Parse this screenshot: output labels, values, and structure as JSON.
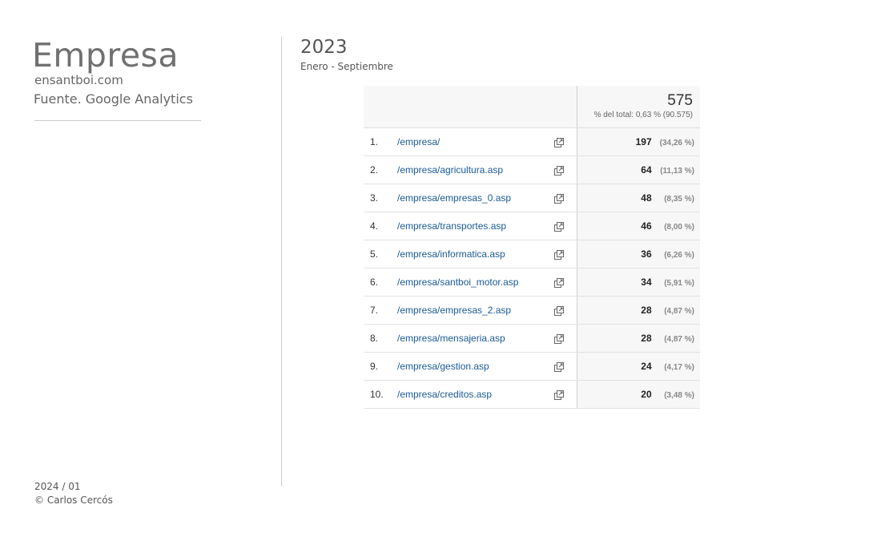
{
  "brand": {
    "title": "Empresa",
    "site": "ensantboi.com",
    "source": "Fuente. Google Analytics"
  },
  "footer": {
    "date": "2024 / 01",
    "copyright": "© Carlos Cercós"
  },
  "period": {
    "year": "2023",
    "range": "Enero - Septiembre"
  },
  "table": {
    "total_value": "575",
    "total_share": "% del total: 0,63 % (90.575)",
    "link_icon": "external-link-icon",
    "rows": [
      {
        "index": "1.",
        "page": "/empresa/",
        "value": "197",
        "pct": "(34,26 %)"
      },
      {
        "index": "2.",
        "page": "/empresa/agricultura.asp",
        "value": "64",
        "pct": "(11,13 %)"
      },
      {
        "index": "3.",
        "page": "/empresa/empresas_0.asp",
        "value": "48",
        "pct": "(8,35 %)"
      },
      {
        "index": "4.",
        "page": "/empresa/transportes.asp",
        "value": "46",
        "pct": "(8,00 %)"
      },
      {
        "index": "5.",
        "page": "/empresa/informatica.asp",
        "value": "36",
        "pct": "(6,26 %)"
      },
      {
        "index": "6.",
        "page": "/empresa/santboi_motor.asp",
        "value": "34",
        "pct": "(5,91 %)"
      },
      {
        "index": "7.",
        "page": "/empresa/empresas_2.asp",
        "value": "28",
        "pct": "(4,87 %)"
      },
      {
        "index": "8.",
        "page": "/empresa/mensajeria.asp",
        "value": "28",
        "pct": "(4,87 %)"
      },
      {
        "index": "9.",
        "page": "/empresa/gestion.asp",
        "value": "24",
        "pct": "(4,17 %)"
      },
      {
        "index": "10.",
        "page": "/empresa/creditos.asp",
        "value": "20",
        "pct": "(3,48 %)"
      }
    ]
  },
  "colors": {
    "link": "#1a5a96",
    "header_bg": "#f7f7f7",
    "divider": "#cccccc"
  }
}
